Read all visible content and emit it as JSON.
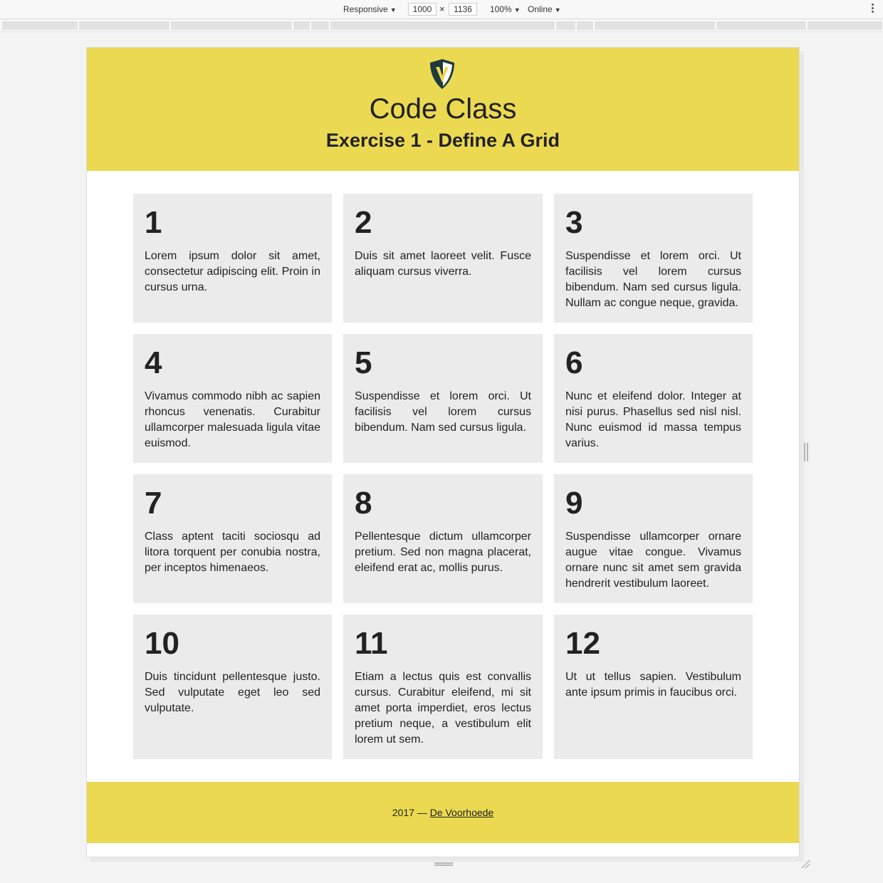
{
  "devtools": {
    "device": "Responsive",
    "width": "1000",
    "height": "1136",
    "zoom": "100%",
    "network": "Online"
  },
  "header": {
    "title": "Code Class",
    "subtitle": "Exercise 1 - Define A Grid",
    "logo_icon": "shield-v-logo-icon"
  },
  "grid": {
    "items": [
      {
        "number": "1",
        "text": "Lorem ipsum dolor sit amet, consectetur adipiscing elit. Proin in cursus urna."
      },
      {
        "number": "2",
        "text": "Duis sit amet laoreet velit. Fusce aliquam cursus viverra."
      },
      {
        "number": "3",
        "text": "Suspendisse et lorem orci. Ut facilisis vel lorem cursus bibendum. Nam sed cursus ligula. Nullam ac congue neque, gravida."
      },
      {
        "number": "4",
        "text": "Vivamus commodo nibh ac sapien rhoncus venenatis. Curabitur ullamcorper malesuada ligula vitae euismod."
      },
      {
        "number": "5",
        "text": "Suspendisse et lorem orci. Ut facilisis vel lorem cursus bibendum. Nam sed cursus ligula."
      },
      {
        "number": "6",
        "text": "Nunc et eleifend dolor. Integer at nisi purus. Phasellus sed nisl nisl. Nunc euismod id massa tempus varius."
      },
      {
        "number": "7",
        "text": "Class aptent taciti sociosqu ad litora torquent per conubia nostra, per inceptos himenaeos."
      },
      {
        "number": "8",
        "text": "Pellentesque dictum ullamcorper pretium. Sed non magna placerat, eleifend erat ac, mollis purus."
      },
      {
        "number": "9",
        "text": "Suspendisse ullamcorper ornare augue vitae congue. Vivamus ornare nunc sit amet sem gravida hendrerit vestibulum laoreet."
      },
      {
        "number": "10",
        "text": "Duis tincidunt pellentesque justo. Sed vulputate eget leo sed vulputate."
      },
      {
        "number": "11",
        "text": "Etiam a lectus quis est convallis cursus. Curabitur eleifend, mi sit amet porta imperdiet, eros lectus pretium neque, a vestibulum elit lorem ut sem."
      },
      {
        "number": "12",
        "text": "Ut ut tellus sapien. Vestibulum ante ipsum primis in faucibus orci."
      }
    ]
  },
  "footer": {
    "year_text": "2017 —",
    "link_label": "De Voorhoede"
  },
  "colors": {
    "brand_yellow": "#ebd952",
    "cell_background": "#ebebeb",
    "text": "#222222"
  }
}
